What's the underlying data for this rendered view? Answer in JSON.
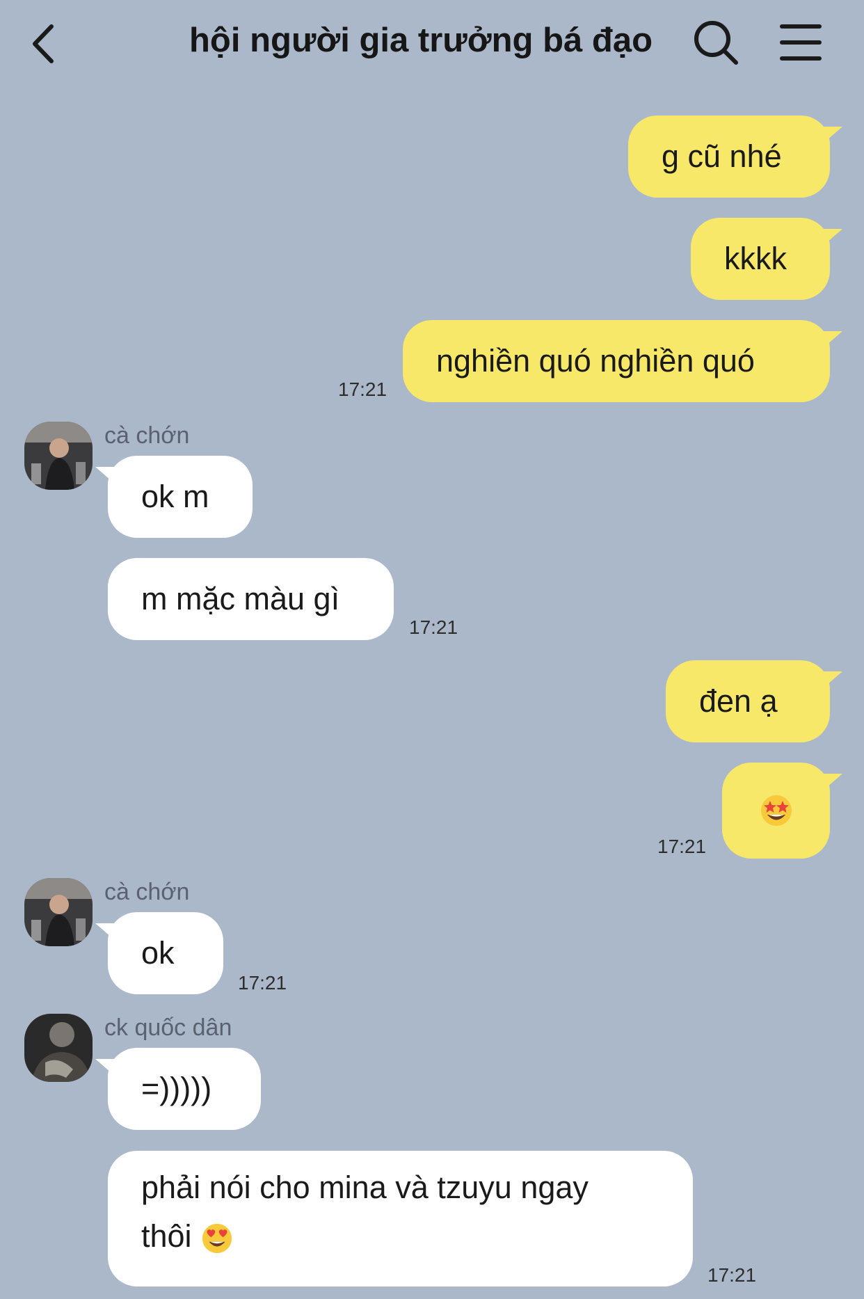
{
  "header": {
    "title": "hội người gia trưởng bá đạo",
    "back_icon": "chevron-left-icon",
    "search_icon": "search-icon",
    "menu_icon": "hamburger-menu-icon"
  },
  "colors": {
    "background": "#abb8c9",
    "outgoing_bubble": "#f7e86a",
    "incoming_bubble": "#ffffff"
  },
  "messages": [
    {
      "direction": "out",
      "text": "g cũ nhé"
    },
    {
      "direction": "out",
      "text": "kkkk"
    },
    {
      "direction": "out",
      "text": "nghiền quó nghiền quó",
      "time": "17:21"
    },
    {
      "direction": "in",
      "sender": "cà chớn",
      "text": "ok m"
    },
    {
      "direction": "in",
      "text": "m mặc màu gì",
      "time": "17:21"
    },
    {
      "direction": "out",
      "text": "đen ạ"
    },
    {
      "direction": "out",
      "emoji": "star-struck-emoji",
      "time": "17:21"
    },
    {
      "direction": "in",
      "sender": "cà chớn",
      "text": "ok",
      "time": "17:21"
    },
    {
      "direction": "in",
      "sender": "ck quốc dân",
      "text": "=)))))"
    },
    {
      "direction": "in",
      "text_line1": "phải nói cho mina và tzuyu ngay",
      "text_line2": "thôi",
      "emoji": "heart-eyes-emoji",
      "time": "17:21"
    }
  ]
}
